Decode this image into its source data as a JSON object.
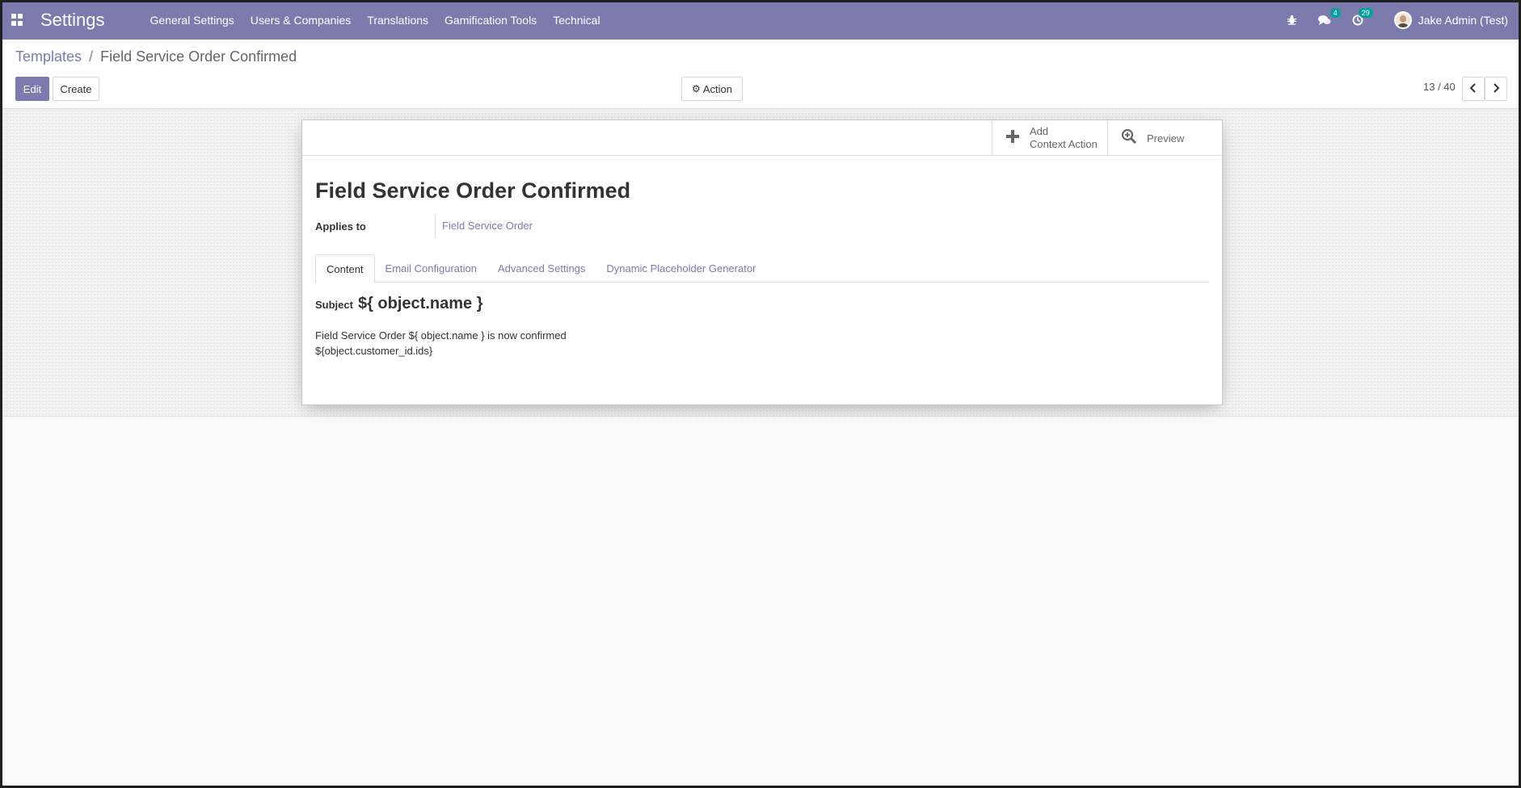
{
  "app": {
    "title": "Settings"
  },
  "menu": [
    "General Settings",
    "Users & Companies",
    "Translations",
    "Gamification Tools",
    "Technical"
  ],
  "systray": {
    "messages_badge": "4",
    "activities_badge": "29",
    "user_name": "Jake Admin (Test)"
  },
  "breadcrumb": {
    "parent": "Templates",
    "separator": "/",
    "current": "Field Service Order Confirmed"
  },
  "toolbar": {
    "edit_label": "Edit",
    "create_label": "Create",
    "action_label": "Action"
  },
  "pager": {
    "value": "13 / 40"
  },
  "smart_buttons": {
    "context_action_line1": "Add",
    "context_action_line2": "Context Action",
    "preview_label": "Preview"
  },
  "record": {
    "title": "Field Service Order Confirmed",
    "applies_to_label": "Applies to",
    "applies_to_value": "Field Service Order"
  },
  "tabs": [
    "Content",
    "Email Configuration",
    "Advanced Settings",
    "Dynamic Placeholder Generator"
  ],
  "content": {
    "subject_label": "Subject",
    "subject_value": "${ object.name }",
    "body_line1": "Field Service Order ${ object.name } is now confirmed",
    "body_line2": "${object.customer_id.ids}"
  },
  "colors": {
    "brand": "#7c7bad",
    "badge": "#00a09d"
  }
}
